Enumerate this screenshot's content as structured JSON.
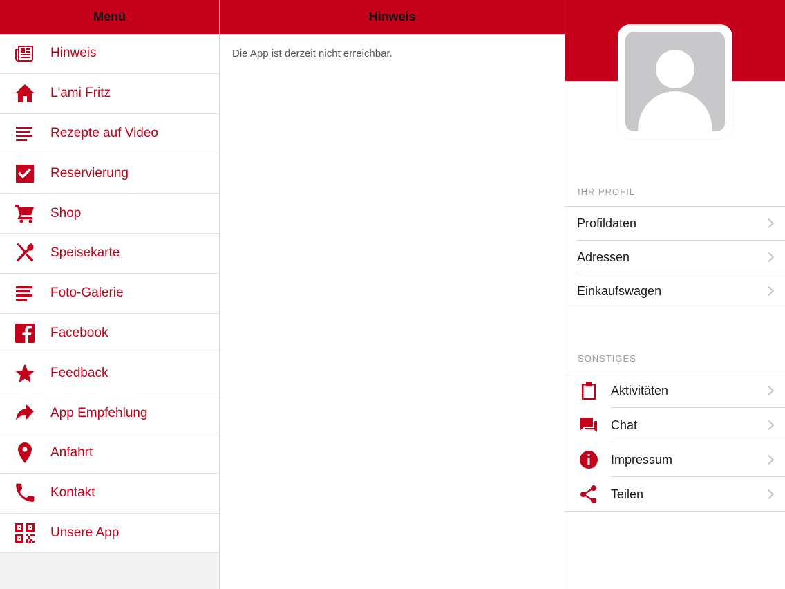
{
  "menu": {
    "title": "Menü",
    "items": [
      {
        "label": "Hinweis",
        "icon": "newspaper-icon"
      },
      {
        "label": "L'ami Fritz",
        "icon": "home-icon"
      },
      {
        "label": "Rezepte auf Video",
        "icon": "list-icon"
      },
      {
        "label": "Reservierung",
        "icon": "checkbox-icon"
      },
      {
        "label": "Shop",
        "icon": "cart-icon"
      },
      {
        "label": "Speisekarte",
        "icon": "cutlery-icon"
      },
      {
        "label": "Foto-Galerie",
        "icon": "list-icon"
      },
      {
        "label": "Facebook",
        "icon": "facebook-icon"
      },
      {
        "label": "Feedback",
        "icon": "star-icon"
      },
      {
        "label": "App Empfehlung",
        "icon": "share-arrow-icon"
      },
      {
        "label": "Anfahrt",
        "icon": "map-pin-icon"
      },
      {
        "label": "Kontakt",
        "icon": "phone-icon"
      },
      {
        "label": "Unsere App",
        "icon": "qr-code-icon"
      }
    ]
  },
  "center": {
    "title": "Hinweis",
    "message": "Die App ist derzeit nicht erreichbar."
  },
  "profile": {
    "section_profile": "IHR PROFIL",
    "profile_items": [
      "Profildaten",
      "Adressen",
      "Einkaufswagen"
    ],
    "section_other": "SONSTIGES",
    "other_items": [
      {
        "label": "Aktivitäten",
        "icon": "clipboard-icon"
      },
      {
        "label": "Chat",
        "icon": "chat-icon"
      },
      {
        "label": "Impressum",
        "icon": "info-icon"
      },
      {
        "label": "Teilen",
        "icon": "share-icon"
      }
    ]
  },
  "colors": {
    "brand": "#c4001a",
    "avatar_placeholder": "#c8c8ca"
  }
}
